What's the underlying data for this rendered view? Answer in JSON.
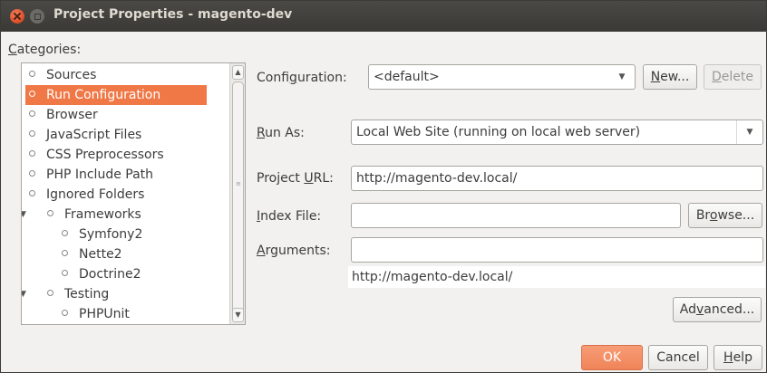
{
  "window": {
    "title": "Project Properties - magento-dev"
  },
  "categories": {
    "label_pre": "",
    "label_mn": "C",
    "label_post": "ategories:",
    "items": [
      {
        "label": "Sources",
        "selected": false
      },
      {
        "label": "Run Configuration",
        "selected": true
      },
      {
        "label": "Browser",
        "selected": false
      },
      {
        "label": "JavaScript Files",
        "selected": false
      },
      {
        "label": "CSS Preprocessors",
        "selected": false
      },
      {
        "label": "PHP Include Path",
        "selected": false
      },
      {
        "label": "Ignored Folders",
        "selected": false
      },
      {
        "label": "Frameworks",
        "expanded": true
      },
      {
        "label": "Symfony2"
      },
      {
        "label": "Nette2"
      },
      {
        "label": "Doctrine2"
      },
      {
        "label": "Testing",
        "expanded": true
      },
      {
        "label": "PHPUnit"
      }
    ]
  },
  "configuration": {
    "label_pre": "Confi",
    "label_mn": "g",
    "label_post": "uration:",
    "value": "<default>",
    "new_pre": "",
    "new_mn": "N",
    "new_post": "ew...",
    "delete_pre": "",
    "delete_mn": "D",
    "delete_post": "elete"
  },
  "run_as": {
    "label_pre": "",
    "label_mn": "R",
    "label_post": "un As:",
    "value": "Local Web Site (running on local web server)"
  },
  "project_url": {
    "label_pre": "Project ",
    "label_mn": "U",
    "label_post": "RL:",
    "value": "http://magento-dev.local/"
  },
  "index_file": {
    "label_pre": "",
    "label_mn": "I",
    "label_post": "ndex File:",
    "value": "",
    "browse_pre": "Br",
    "browse_mn": "o",
    "browse_post": "wse..."
  },
  "arguments": {
    "label_pre": "",
    "label_mn": "A",
    "label_post": "rguments:",
    "value": ""
  },
  "resolved_url": "http://magento-dev.local/",
  "advanced": {
    "pre": "Ad",
    "mn": "v",
    "post": "anced..."
  },
  "footer": {
    "ok": "OK",
    "cancel": "Cancel",
    "help_pre": "",
    "help_mn": "H",
    "help_post": "elp"
  },
  "colors": {
    "selection": "#f07746",
    "titlebar": "#3f3e3a",
    "ok_button": "#f08458"
  }
}
